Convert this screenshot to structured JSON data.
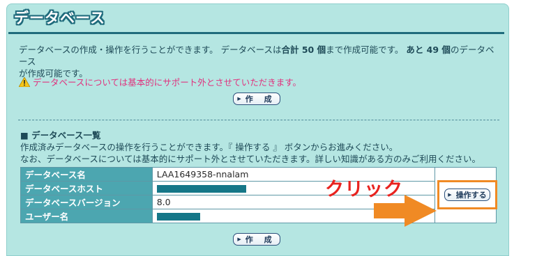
{
  "page": {
    "title": "データベース",
    "intro_line1_a": "データベースの作成・操作を行うことができます。 データベースは",
    "intro_total": "合計 50 個",
    "intro_line1_b": "まで作成可能です。 ",
    "intro_remain": "あと 49 個",
    "intro_line1_c": "のデータベース",
    "intro_line2": "が作成可能です。",
    "warning": "データベースについては基本的にサポート外とさせていただきます。",
    "create_button": "作 成",
    "section_title": "■ データベース一覧",
    "section_desc_line1": "作成済みデータベースの操作を行うことができます。『 操作する 』 ボタンからお進みください。",
    "section_desc_line2": "なお、データベースについては基本的にサポート外とさせていただきます。詳しい知識がある方のみご利用ください。"
  },
  "db_table": {
    "rows": [
      {
        "label": "データベース名",
        "value": "LAA1649358-nnalam"
      },
      {
        "label": "データベースホスト",
        "value": ""
      },
      {
        "label": "データベースバージョン",
        "value": "8.0"
      },
      {
        "label": "ユーザー名",
        "value": ""
      }
    ],
    "operate_button": "操作する"
  },
  "annotation": {
    "click_label": "クリック",
    "arrow_color": "#f08a24",
    "highlight_color": "#f08a24"
  },
  "colors": {
    "panel_bg": "#b5e6e2",
    "accent": "#1f6b7c",
    "table_head": "#4ca6b0",
    "warning_text": "#e0337e"
  },
  "icons": {
    "warning": "warning-triangle-icon",
    "button_arrow": "play-arrow-icon"
  }
}
